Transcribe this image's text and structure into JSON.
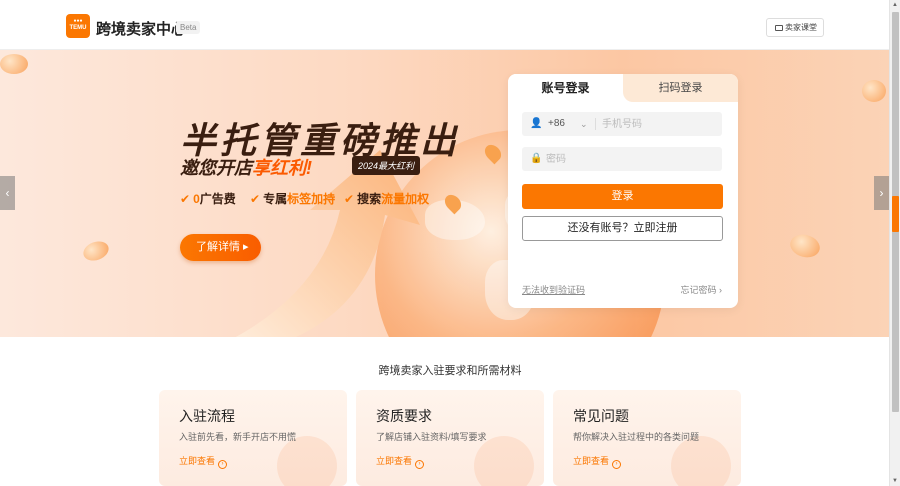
{
  "header": {
    "logo_text": "TEMU",
    "title": "跨境卖家中心",
    "beta": "Beta",
    "class_button": "卖家课堂"
  },
  "hero": {
    "headline": "半托管重磅推出",
    "subline_prefix": "邀您开店",
    "subline_highlight": "享红利!",
    "badge": "2024最大红利",
    "features": [
      {
        "prefix": "0",
        "text": "广告费"
      },
      {
        "prefix": "专属",
        "text": "标签加持"
      },
      {
        "prefix": "搜索",
        "text": "流量加权"
      }
    ],
    "learn_more": "了解详情 ▸",
    "prev_arrow": "‹",
    "next_arrow": "›"
  },
  "login": {
    "tab_account": "账号登录",
    "tab_qr": "扫码登录",
    "country_code": "+86",
    "phone_placeholder": "手机号码",
    "password_placeholder": "密码",
    "login_button": "登录",
    "register_button": "还没有账号？立即注册",
    "sms_link": "无法收到验证码",
    "forgot_link": "忘记密码 ›"
  },
  "section": {
    "title": "跨境卖家入驻要求和所需材料",
    "cards": [
      {
        "title": "入驻流程",
        "desc": "入驻前先看，新手开店不用慌",
        "link": "立即查看"
      },
      {
        "title": "资质要求",
        "desc": "了解店铺入驻资料/填写要求",
        "link": "立即查看"
      },
      {
        "title": "常见问题",
        "desc": "帮你解决入驻过程中的各类问题",
        "link": "立即查看"
      }
    ]
  },
  "colors": {
    "accent": "#fb7701",
    "hero_bg": "#fdd9c2",
    "dark_text": "#3a1e10"
  },
  "icons": [
    "book-icon",
    "user-icon",
    "lock-icon",
    "chevron-down-icon",
    "chevron-left-icon",
    "chevron-right-icon",
    "info-circle-icon",
    "check-icon"
  ]
}
